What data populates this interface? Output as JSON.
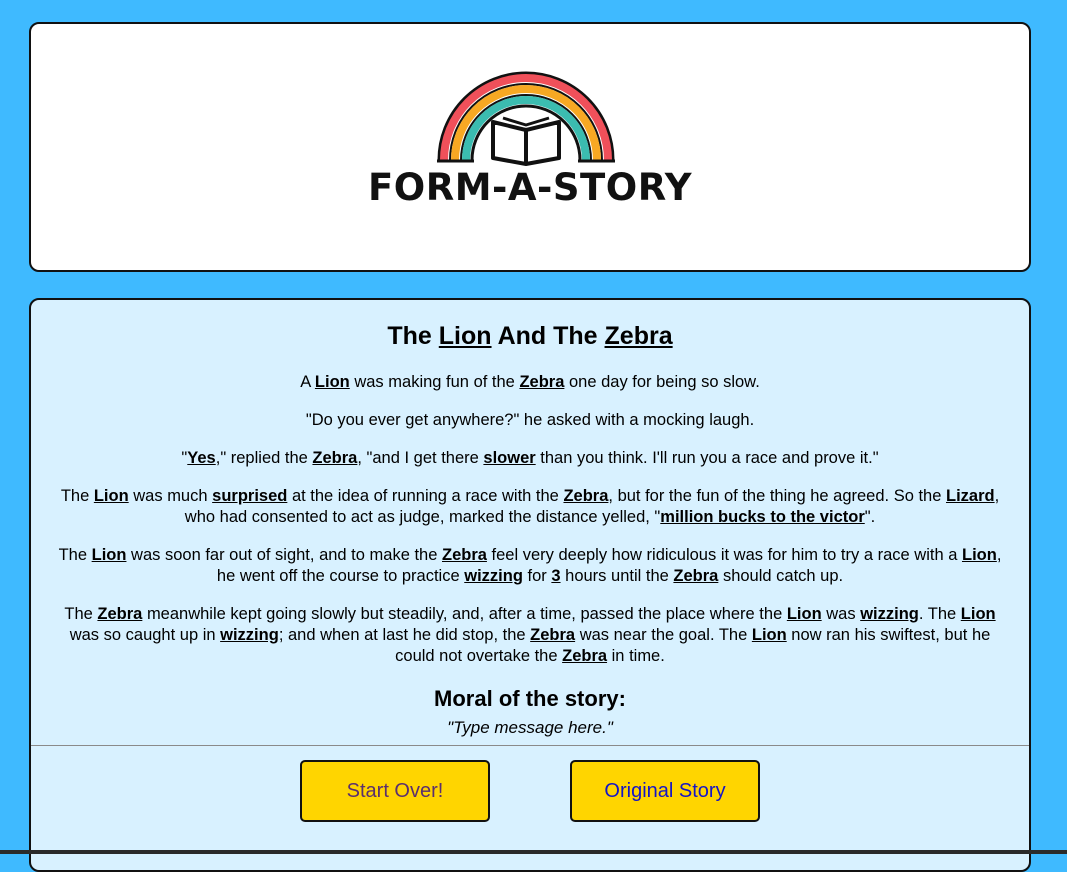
{
  "logo": {
    "text": "FORM-A-STORY",
    "icon": "rainbow-book-icon",
    "colors": [
      "#f0505a",
      "#f7a823",
      "#3bbcb0"
    ]
  },
  "story": {
    "title_prefix": "The",
    "title_word1": "Lion",
    "title_mid": "And The",
    "title_word2": "Zebra",
    "p1": {
      "t1": "A",
      "w1": "Lion",
      "t2": "was making fun of the",
      "w2": "Zebra",
      "t3": "one day for being so slow."
    },
    "p2": {
      "t1": "\"Do you ever get anywhere?\" he asked with a mocking laugh."
    },
    "p3": {
      "t1": "\"",
      "w1": "Yes",
      "t2": ",\" replied the",
      "w2": "Zebra",
      "t3": ", \"and I get there",
      "w3": "slower",
      "t4": "than you think. I'll run you a race and prove it.\""
    },
    "p4": {
      "t1": "The",
      "w1": "Lion",
      "t2": "was much",
      "w2": "surprised",
      "t3": "at the idea of running a race with the",
      "w3": "Zebra",
      "t4": ", but for the fun of the thing he agreed. So the",
      "w4": "Lizard",
      "t5": ", who had consented to act as judge, marked the distance yelled, \"",
      "w5": "million bucks to the victor",
      "t6": "\"."
    },
    "p5": {
      "t1": "The",
      "w1": "Lion",
      "t2": "was soon far out of sight, and to make the",
      "w2": "Zebra",
      "t3": "feel very deeply how ridiculous it was for him to try a race with a",
      "w3": "Lion",
      "t4": ", he went off the course to practice",
      "w4": "wizzing",
      "t5": "for",
      "w5": "3",
      "t6": "hours until the",
      "w6": "Zebra",
      "t7": "should catch up."
    },
    "p6": {
      "t1": "The",
      "w1": "Zebra",
      "t2": "meanwhile kept going slowly but steadily, and, after a time, passed the place where the",
      "w2": "Lion",
      "t3": "was",
      "w3": "wizzing",
      "t4": ". The",
      "w4": "Lion",
      "t5": "was so caught up in",
      "w5": "wizzing",
      "t6": "; and when at last he did stop, the",
      "w6": "Zebra",
      "t7": "was near the goal. The",
      "w7": "Lion",
      "t8": "now ran his swiftest, but he could not overtake the",
      "w8": "Zebra",
      "t9": "in time."
    },
    "moral_heading": "Moral of the story:",
    "moral_text": "\"Type message here.\""
  },
  "buttons": {
    "start_over": "Start Over!",
    "original_story": "Original Story"
  }
}
